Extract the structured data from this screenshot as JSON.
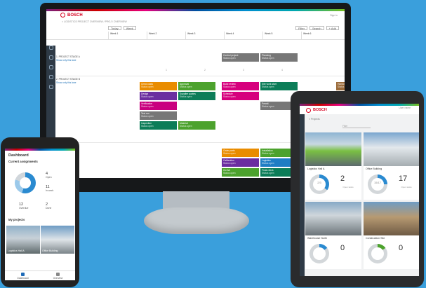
{
  "monitor": {
    "brand": "BOSCH",
    "breadcrumb": "< LOGISTICS PROJECT OVERVIEW / PROJ / OVERVIEW",
    "user": "Sign in",
    "toolbar": {
      "today": "Today",
      "week": "Week",
      "filter": "Filter",
      "search": "Search",
      "add": "+ Add"
    },
    "weeks": [
      "Week 1",
      "Week 2",
      "Week 3",
      "Week 4",
      "Week 5",
      "Week 6"
    ],
    "lanes": [
      {
        "name": "1. PROJECT STAGE A",
        "link": "Show only this lane"
      },
      {
        "name": "2. PROJECT STAGE B",
        "link": "Show only this lane"
      }
    ],
    "pagination": [
      "1",
      "2",
      "3",
      "4"
    ],
    "cards": [
      {
        "title": "Control project",
        "sub": "Status open",
        "color": "#777777"
      },
      {
        "title": "Planning",
        "sub": "Status open",
        "color": "#777777"
      },
      {
        "title": "Check data",
        "sub": "Status open",
        "color": "#e98c00"
      },
      {
        "title": "Approval",
        "sub": "Status open",
        "color": "#4ca22d"
      },
      {
        "title": "Build review",
        "sub": "Status open",
        "color": "#d6007d"
      },
      {
        "title": "Site work start",
        "sub": "Status open",
        "color": "#0c7d58"
      },
      {
        "title": "Handover",
        "sub": "Status open",
        "color": "#9b6b3a"
      },
      {
        "title": "Design",
        "sub": "Status open",
        "color": "#6b2da0"
      },
      {
        "title": "Supplier quotes",
        "sub": "Status open",
        "color": "#0c7d58"
      },
      {
        "title": "Schedule",
        "sub": "Status open",
        "color": "#d6007d"
      },
      {
        "title": "Permit",
        "sub": "Status open",
        "color": "#777777"
      },
      {
        "title": "Verification",
        "sub": "Status open",
        "color": "#c9007f"
      },
      {
        "title": "Test run",
        "sub": "Status open",
        "color": "#777777"
      },
      {
        "title": "Inspection",
        "sub": "Status open",
        "color": "#0c7d58"
      },
      {
        "title": "Material",
        "sub": "Status open",
        "color": "#4ca22d"
      },
      {
        "title": "Order parts",
        "sub": "Status open",
        "color": "#e98c00"
      },
      {
        "title": "Installation",
        "sub": "Status open",
        "color": "#4ca22d"
      },
      {
        "title": "Assembly",
        "sub": "Status open",
        "color": "#d6007d"
      },
      {
        "title": "Calibration",
        "sub": "Status open",
        "color": "#6b2da0"
      },
      {
        "title": "Logistics",
        "sub": "Status open",
        "color": "#1f7dc4"
      },
      {
        "title": "Cabling",
        "sub": "Status open",
        "color": "#c9007f"
      },
      {
        "title": "Go live",
        "sub": "Status open",
        "color": "#4ca22d"
      },
      {
        "title": "Final check",
        "sub": "Status open",
        "color": "#0c7d58"
      }
    ]
  },
  "phone": {
    "title": "Dashboard",
    "section1": "Current assignments",
    "stats": [
      {
        "value": "4",
        "label": "Open"
      },
      {
        "value": "11",
        "label": "In work"
      },
      {
        "value": "12",
        "label": "Overdue"
      },
      {
        "value": "2",
        "label": "Done"
      }
    ],
    "section2": "My projects",
    "tiles": [
      {
        "caption": "Logistics Hall A"
      },
      {
        "caption": "Office Building"
      }
    ],
    "nav": [
      {
        "label": "Dashboard"
      },
      {
        "label": "Overview"
      }
    ]
  },
  "tablet": {
    "brand": "BOSCH",
    "user": "User name",
    "breadcrumb": "< Projects",
    "filter": "Filter",
    "cards": [
      {
        "name": "Logistics Hall A",
        "ring": "2/3",
        "value": "2",
        "label": "Open tasks",
        "ring_color": "#2a8ad0",
        "ring_pct": 35
      },
      {
        "name": "Office Building",
        "ring": "15/17",
        "value": "17",
        "label": "Open tasks",
        "ring_color": "#2a8ad0",
        "ring_pct": 25
      },
      {
        "name": "Warehouse North",
        "ring": "",
        "value": "0",
        "label": "Open tasks",
        "ring_color": "#2a8ad0",
        "ring_pct": 15
      },
      {
        "name": "Construction Site",
        "ring": "",
        "value": "0",
        "label": "Open tasks",
        "ring_color": "#4ca22d",
        "ring_pct": 15
      }
    ]
  }
}
